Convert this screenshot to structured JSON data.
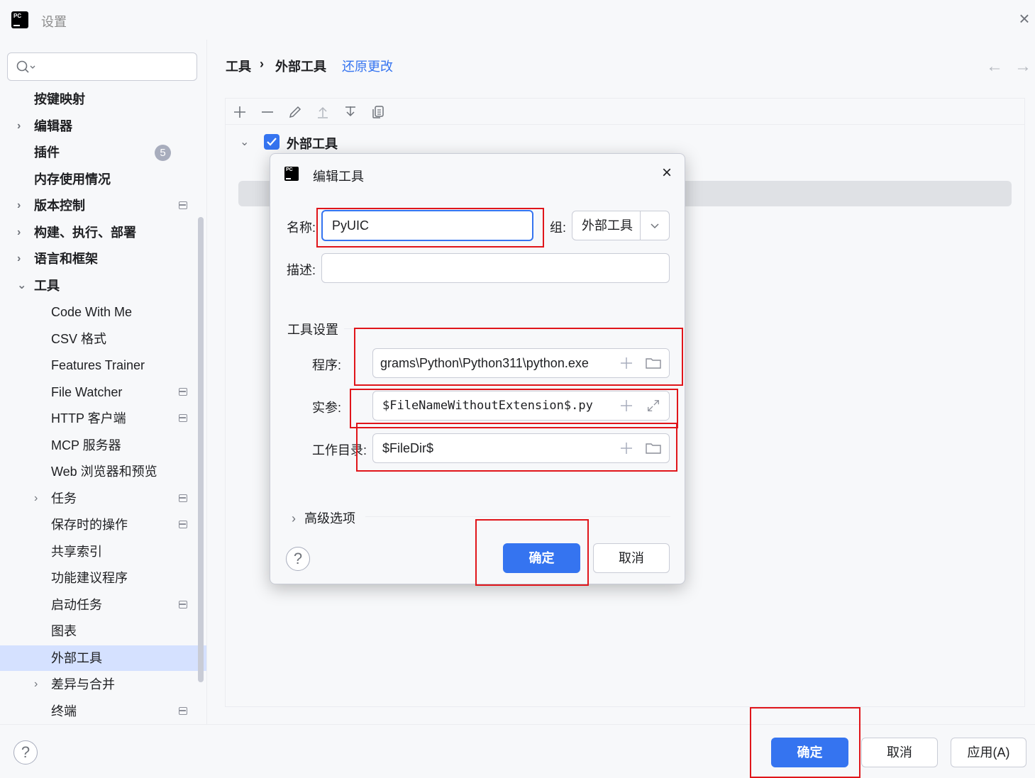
{
  "window": {
    "title": "设置",
    "close_glyph": "×"
  },
  "search": {
    "placeholder": ""
  },
  "sidebar": {
    "items": [
      {
        "label": "按键映射",
        "bold": true,
        "chevron": "",
        "indent": 0
      },
      {
        "label": "编辑器",
        "bold": true,
        "chevron": "›",
        "indent": 0
      },
      {
        "label": "插件",
        "bold": true,
        "chevron": "",
        "indent": 0,
        "badge": "5"
      },
      {
        "label": "内存使用情况",
        "bold": true,
        "chevron": "",
        "indent": 0
      },
      {
        "label": "版本控制",
        "bold": true,
        "chevron": "›",
        "indent": 0,
        "project": true
      },
      {
        "label": "构建、执行、部署",
        "bold": true,
        "chevron": "›",
        "indent": 0
      },
      {
        "label": "语言和框架",
        "bold": true,
        "chevron": "›",
        "indent": 0
      },
      {
        "label": "工具",
        "bold": true,
        "chevron": "⌄",
        "indent": 0
      },
      {
        "label": "Code With Me",
        "bold": false,
        "chevron": "",
        "indent": 1
      },
      {
        "label": "CSV 格式",
        "bold": false,
        "chevron": "",
        "indent": 1
      },
      {
        "label": "Features Trainer",
        "bold": false,
        "chevron": "",
        "indent": 1
      },
      {
        "label": "File Watcher",
        "bold": false,
        "chevron": "",
        "indent": 1,
        "project": true
      },
      {
        "label": "HTTP 客户端",
        "bold": false,
        "chevron": "",
        "indent": 1,
        "project": true
      },
      {
        "label": "MCP 服务器",
        "bold": false,
        "chevron": "",
        "indent": 1
      },
      {
        "label": "Web 浏览器和预览",
        "bold": false,
        "chevron": "",
        "indent": 1
      },
      {
        "label": "任务",
        "bold": false,
        "chevron": "›",
        "indent": 1,
        "project": true
      },
      {
        "label": "保存时的操作",
        "bold": false,
        "chevron": "",
        "indent": 1,
        "project": true
      },
      {
        "label": "共享索引",
        "bold": false,
        "chevron": "",
        "indent": 1
      },
      {
        "label": "功能建议程序",
        "bold": false,
        "chevron": "",
        "indent": 1
      },
      {
        "label": "启动任务",
        "bold": false,
        "chevron": "",
        "indent": 1,
        "project": true
      },
      {
        "label": "图表",
        "bold": false,
        "chevron": "",
        "indent": 1
      },
      {
        "label": "外部工具",
        "bold": false,
        "chevron": "",
        "indent": 1,
        "selected": true
      },
      {
        "label": "差异与合并",
        "bold": false,
        "chevron": "›",
        "indent": 1
      },
      {
        "label": "终端",
        "bold": false,
        "chevron": "",
        "indent": 1,
        "project": true
      }
    ]
  },
  "breadcrumb": {
    "parent": "工具",
    "separator": "›",
    "current": "外部工具",
    "revert_link": "还原更改"
  },
  "nav": {
    "back_glyph": "←",
    "forward_glyph": "→"
  },
  "toolbar": {
    "icons": [
      "add-icon",
      "remove-icon",
      "edit-icon",
      "move-up-icon",
      "move-down-icon",
      "copy-icon"
    ]
  },
  "tool_group": {
    "label": "外部工具",
    "checked": true,
    "chevron": "⌄"
  },
  "dialog": {
    "title": "编辑工具",
    "close_glyph": "×",
    "name_label": "名称:",
    "name_value": "PyUIC",
    "group_label": "组:",
    "group_value": "外部工具",
    "description_label": "描述:",
    "description_value": "",
    "tool_settings_title": "工具设置",
    "program_label": "程序:",
    "program_value": "grams\\Python\\Python311\\python.exe",
    "arguments_label": "实参:",
    "arguments_value": "$FileNameWithoutExtension$.py",
    "workdir_label": "工作目录:",
    "workdir_value": "$FileDir$",
    "advanced_label": "高级选项",
    "advanced_chevron": "›",
    "ok_label": "确定",
    "cancel_label": "取消",
    "help_glyph": "?"
  },
  "footer": {
    "help_glyph": "?",
    "ok_label": "确定",
    "cancel_label": "取消",
    "apply_label": "应用(A)"
  },
  "colors": {
    "accent": "#3574f0",
    "selection": "#d5e1ff",
    "annotation_red": "#e0151a"
  }
}
